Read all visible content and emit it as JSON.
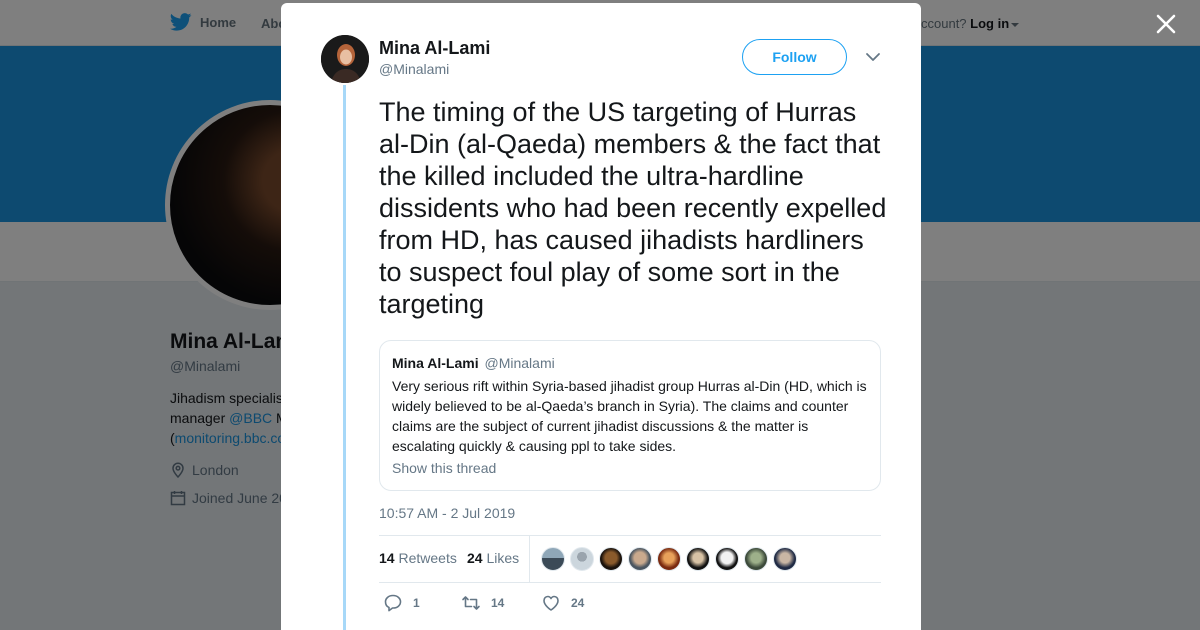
{
  "nav": {
    "home_label": "Home",
    "about_label": "Abo",
    "account_text": "ccount?",
    "login_label": "Log in"
  },
  "profile": {
    "name": "Mina Al-Lam",
    "handle": "@Minalami",
    "bio_line1": "Jihadism specialis",
    "bio_line2_pre": "manager ",
    "bio_link1": "@BBC",
    "bio_line2_post": " M",
    "bio_line3_pre": "(",
    "bio_link2": "monitoring.bbc.co",
    "location": "London",
    "joined": "Joined June 20"
  },
  "tweet": {
    "author_name": "Mina Al-Lami",
    "author_handle": "@Minalami",
    "follow_label": "Follow",
    "text": "The timing of the US targeting of Hurras al-Din (al-Qaeda) members & the fact that the killed included the ultra-hardline dissidents who had been recently expelled from HD, has caused jihadists hardliners to suspect foul play of some sort in the targeting",
    "quote": {
      "name": "Mina Al-Lami",
      "handle": "@Minalami",
      "text": "Very serious rift within Syria-based jihadist group Hurras al-Din (HD, which is widely believed to be al-Qaeda’s branch in Syria). The claims and counter claims are the subject of current jihadist discussions & the matter is escalating quickly & causing ppl to take sides.",
      "show_thread": "Show this thread"
    },
    "timestamp": "10:57 AM - 2 Jul 2019",
    "retweets_count": "14",
    "retweets_label": "Retweets",
    "likes_count": "24",
    "likes_label": "Likes",
    "reply_count": "1",
    "retweet_action_count": "14",
    "like_action_count": "24"
  },
  "colors": {
    "brand_blue": "#1da1f2",
    "banner_blue": "#1b95e0",
    "thread_line": "#a7d8f8",
    "text_secondary": "#657786"
  },
  "likers": [
    {
      "bg": "linear-gradient(#8fa7b8 0 45%, #3b4a57 45%)"
    },
    {
      "bg": "radial-gradient(circle at 50% 40%, #9aa4ad 0 28%, #ccd6dd 29%)"
    },
    {
      "bg": "radial-gradient(circle at 50% 45%, #8a5a2b 0 35%, #1a120c 60%)"
    },
    {
      "bg": "radial-gradient(circle at 50% 45%, #c9a98d 0 35%, #4a5560 60%)"
    },
    {
      "bg": "radial-gradient(circle at 50% 45%, #e8a15a 0 30%, #7a2a10 60%)"
    },
    {
      "bg": "radial-gradient(circle at 50% 45%, #d7c2a5 0 30%, #111 60%)"
    },
    {
      "bg": "radial-gradient(circle at 50% 45%, #f2f2f2 0 35%, #111 60%)"
    },
    {
      "bg": "radial-gradient(circle at 50% 45%, #9db08a 0 30%, #3c4a3a 60%)"
    },
    {
      "bg": "radial-gradient(circle at 50% 45%, #c9b6a4 0 30%, #1f2a44 60%)"
    }
  ]
}
